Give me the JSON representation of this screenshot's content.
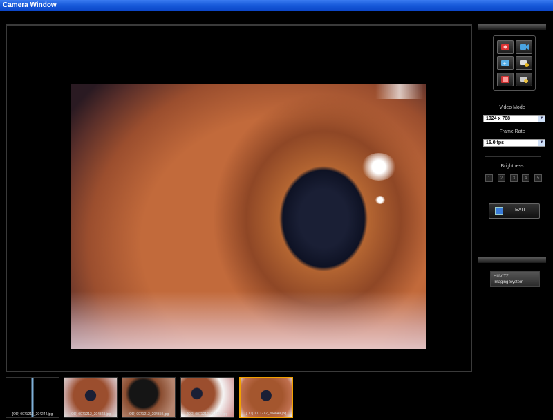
{
  "window": {
    "title": "Camera Window"
  },
  "viewer": {
    "image_description": "Iris image"
  },
  "toolbar": {
    "icons": [
      "camera-capture-icon",
      "video-record-icon",
      "exposure-icon",
      "camera-settings-icon",
      "gallery-icon",
      "settings-icon"
    ]
  },
  "video_mode": {
    "label": "Video Mode",
    "value": "1024 x 768"
  },
  "frame_rate": {
    "label": "Frame Rate",
    "value": "15.0 fps"
  },
  "brightness": {
    "label": "Brightness",
    "levels": [
      "1",
      "2",
      "3",
      "4",
      "5"
    ]
  },
  "exit": {
    "label": "EXIT"
  },
  "brand": {
    "line1": "HUVITZ",
    "line2": "Imaging System"
  },
  "thumbnails": [
    {
      "caption": "[OD] 0071212_204244.jpg"
    },
    {
      "caption": "[OD] 0071212_204323.jpg"
    },
    {
      "caption": "[OD] 0071212_204359.jpg"
    },
    {
      "caption": "[OD] 0071212_204414.jpg"
    },
    {
      "caption": "[OD] 0071212_204849.jpg"
    }
  ],
  "colors": {
    "accent": "#f2a200",
    "title_bar": "#1658d8",
    "background": "#000000"
  }
}
